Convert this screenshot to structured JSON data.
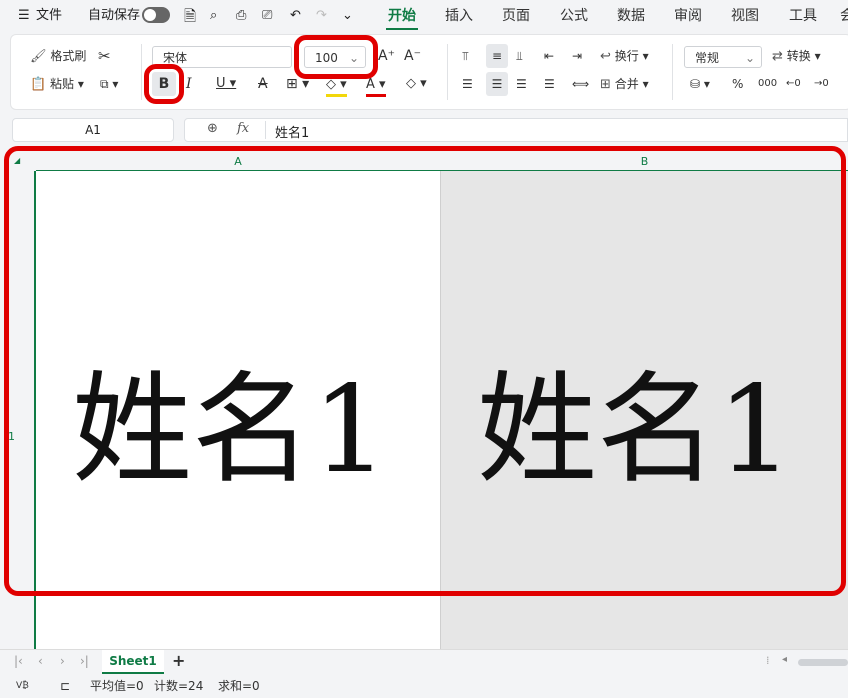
{
  "menubar": {
    "menu_label": "文件",
    "autosave_label": "自动保存",
    "tabs": [
      "开始",
      "插入",
      "页面",
      "公式",
      "数据",
      "审阅",
      "视图",
      "工具",
      "会"
    ]
  },
  "ribbon": {
    "format_painter": "格式刷",
    "paste": "粘贴",
    "font_name": "宋体",
    "font_size": "100",
    "bold": "B",
    "italic": "I",
    "underline": "U",
    "wrap": "换行",
    "merge": "合并",
    "number_format": "常规",
    "convert": "转换"
  },
  "formula_bar": {
    "cell_ref": "A1",
    "fx": "fx",
    "content": "姓名1"
  },
  "grid": {
    "columns": [
      "A",
      "B"
    ],
    "row": "1",
    "cell_a1": "姓名1",
    "cell_b1": "姓名1"
  },
  "sheets": {
    "active": "Sheet1",
    "add": "+"
  },
  "status": {
    "average": "平均值=0",
    "count": "计数=24",
    "sum": "求和=0"
  },
  "colors": {
    "accent": "#0f7b45",
    "highlight": "#e00000"
  }
}
